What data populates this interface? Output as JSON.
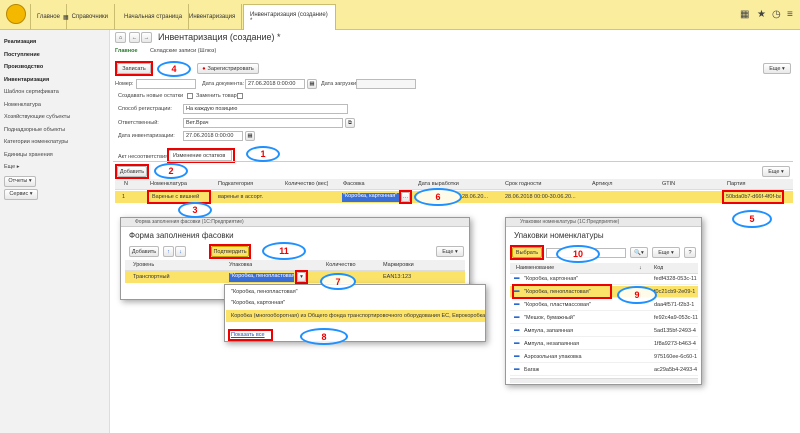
{
  "topbar": {
    "home": "Главное",
    "refs": "Справочники",
    "start": "Начальная страница",
    "inv": "Инвентаризация",
    "inv_new": "Инвентаризация (создание) *"
  },
  "sidebar": [
    "Реализация",
    "Поступление",
    "Производство",
    "Инвентаризация",
    "Шаблон сертификата",
    "Номенклатура",
    "Хозяйствующие субъекты",
    "Поднадзорные объекты",
    "Категории номенклатуры",
    "Единицы хранения",
    "Еще",
    "Отчеты",
    "Сервис"
  ],
  "doc": {
    "title": "Инвентаризация (создание) *",
    "link_main": "Главное",
    "link_ws": "Складские записи (Шлюз)",
    "save": "Записать",
    "register": "Зарегистрировать",
    "more": "Еще",
    "num_label": "Номер:",
    "date_label": "Дата документа:",
    "date_value": "27.06.2018 0:00:00",
    "load_label": "Дата загрузки:",
    "create_new": "Создавать новые остатки",
    "replace": "Заменить товар",
    "reg_label": "Способ регистрации:",
    "reg_value": "На каждую позицию",
    "resp_label": "Ответственный:",
    "resp_value": "Вет.Врач",
    "invdate_label": "Дата инвентаризации:",
    "invdate_value": "27.06.2018 0:00:00"
  },
  "tabs": [
    "Акт несоответствия",
    "Изменение остатков"
  ],
  "table": {
    "add": "Добавить",
    "more": "Еще",
    "cols": [
      "N",
      "Номенклатура",
      "Подкатегория",
      "Количество (вес)",
      "Фасовка",
      "Дата выработки",
      "Срок годности",
      "Артикул",
      "GTIN",
      "Партия"
    ],
    "row": [
      "1",
      "Варенье с вишней",
      "варенье в ассорт.",
      "",
      "\"Коробка, картонная\"",
      "28.06.20...",
      "28.06.2018 00:00-30.06.20...",
      "",
      "",
      "50bda0b7-d66f-4f0f-ba"
    ]
  },
  "dlg1": {
    "wintitle": "Форма заполнения фасовки (1С:Предприятие)",
    "title": "Форма заполнения фасовки",
    "add": "Добавить",
    "pick": "Подтвердить",
    "more": "Еще",
    "cols": [
      "Уровень",
      "Упаковка",
      "Количество",
      "Маркировки"
    ],
    "row": [
      "Транспортный",
      "\"Коробка, пенопластовая\"",
      "",
      "EAN13:123"
    ]
  },
  "dropdown": {
    "items": [
      "\"Коробка, пенопластовая\"",
      "\"Коробка, картонная\"",
      "Коробка (многооборотная) из Общего фонда транспортировочного оборудования ЕС, Еврокоробка"
    ],
    "showall": "Показать все"
  },
  "dlg2": {
    "wintitle": "Упаковки номенклатуры (1С:Предприятие)",
    "title": "Упаковки номенклатуры",
    "pick": "Выбрать",
    "more": "Еще",
    "help": "?",
    "cols": [
      "Наименование",
      "Код"
    ],
    "rows": [
      [
        "\"Коробка, картонная\"",
        "fedf4328-053c-11"
      ],
      [
        "\"Коробка, пенопластовая\"",
        "f0c21cb9-2e09-1"
      ],
      [
        "\"Коробка, пластмассовая\"",
        "daa4f571-f2b3-1"
      ],
      [
        "\"Мешок, бумажный\"",
        "fe92c4a9-053c-11"
      ],
      [
        "Ампула, запаянная",
        "5ad135bf-2493-4"
      ],
      [
        "Ампула, незапаянная",
        "1f8a9273-b463-4"
      ],
      [
        "Аэрозольная упаковка",
        "975160ee-6c60-1"
      ],
      [
        "Багаж",
        "ac29a5b4-2493-4"
      ]
    ]
  },
  "callouts": [
    "1",
    "2",
    "3",
    "4",
    "5",
    "6",
    "7",
    "8",
    "9",
    "10",
    "11"
  ]
}
